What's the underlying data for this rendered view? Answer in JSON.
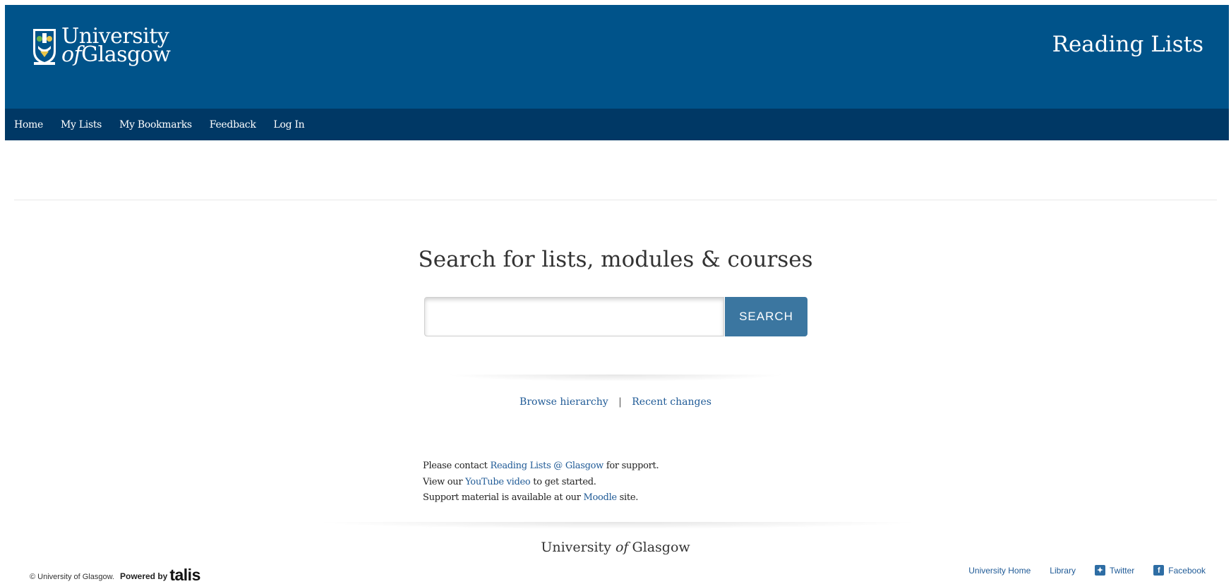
{
  "header": {
    "logo_line1": "University",
    "logo_line2_italic": "of",
    "logo_line2_rest": "Glasgow",
    "site_title": "Reading Lists",
    "brand_color": "#00538a",
    "nav_color": "#003865"
  },
  "nav": {
    "items": [
      {
        "label": "Home"
      },
      {
        "label": "My Lists"
      },
      {
        "label": "My Bookmarks"
      },
      {
        "label": "Feedback"
      },
      {
        "label": "Log In"
      }
    ]
  },
  "search": {
    "heading": "Search for lists, modules & courses",
    "input_value": "",
    "input_placeholder": "",
    "button_label": "SEARCH",
    "button_color": "#3b76a0"
  },
  "links": {
    "browse": "Browse hierarchy",
    "separator": "|",
    "recent": "Recent changes"
  },
  "support": {
    "line1_pre": "Please contact",
    "line1_link": "Reading Lists @ Glasgow",
    "line1_post": "for support.",
    "line2_pre": "View our",
    "line2_link": "YouTube video",
    "line2_post": "to get started.",
    "line3_pre": "Support material is available at our",
    "line3_link": "Moodle",
    "line3_post": "site."
  },
  "footer": {
    "brand_pre": "University",
    "brand_italic": "of",
    "brand_post": "Glasgow",
    "copyright": "© University of Glasgow.",
    "powered_by": "Powered by",
    "talis": "talis",
    "links": {
      "university_home": "University Home",
      "library": "Library",
      "twitter": "Twitter",
      "facebook": "Facebook"
    },
    "icons": {
      "twitter": "twitter-icon",
      "facebook": "facebook-icon"
    }
  }
}
